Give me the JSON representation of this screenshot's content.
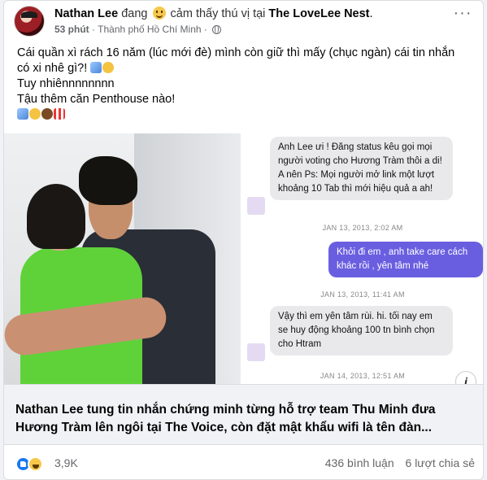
{
  "post": {
    "author": "Nathan Lee",
    "feeling_prefix": "đang",
    "feeling_text": "cảm thấy thú vị tại",
    "place": "The LoveLee Nest",
    "time": "53 phút",
    "separator": "·",
    "location": "Thành phố Hồ Chí Minh",
    "separator2": "·",
    "more_label": "···",
    "lines": [
      "Cái quần xì rách 16 năm (lúc mới đè) mình còn giữ thì mấy (chục ngàn) cái tin nhắn",
      "có xi nhê gì?!",
      "Tuy nhiênnnnnnnn",
      "Tậu thêm căn Penthouse nào!"
    ]
  },
  "chat": {
    "messages": [
      {
        "dir": "in",
        "text": "Anh Lee ưi ! Đăng status kêu gọi mọi người voting cho Hương Tràm thôi a di! A nên Ps: Mọi người mở link một lượt khoảng 10 Tab thì mới hiệu quả a ah!"
      },
      {
        "dir": "stamp",
        "text": "JAN 13, 2013, 2:02 AM"
      },
      {
        "dir": "out",
        "text": "Khỏi đi em , anh take care cách khác rồi , yên tâm nhé"
      },
      {
        "dir": "stamp",
        "text": "JAN 13, 2013, 11:41 AM"
      },
      {
        "dir": "in",
        "text": "Vậy thì em yên tâm rùi. hi. tối nay em se huy động khoảng 100 tn bình chọn cho Htram"
      },
      {
        "dir": "stamp",
        "text": "JAN 14, 2013, 12:51 AM"
      }
    ],
    "info_label": "i"
  },
  "link": {
    "title": "Nathan Lee tung tin nhắn chứng minh từng hỗ trợ team Thu Minh đưa Hương Tràm lên ngôi tại The Voice, còn đặt mật khẩu wifi là tên đàn..."
  },
  "stats": {
    "reactions": "3,9K",
    "comments": "436 bình luận",
    "shares": "6 lượt chia sẻ"
  },
  "icons": {
    "avatar": "profile-avatar",
    "feeling": "smiling-face-icon",
    "privacy": "globe-icon",
    "line2_emoji": [
      "wave-icon",
      "laughing-face-icon"
    ],
    "line5_emoji": [
      "wave-icon",
      "grinning-face-icon",
      "coconut-icon",
      "popcorn-icon"
    ],
    "reactions": [
      "like-icon",
      "haha-icon"
    ]
  }
}
